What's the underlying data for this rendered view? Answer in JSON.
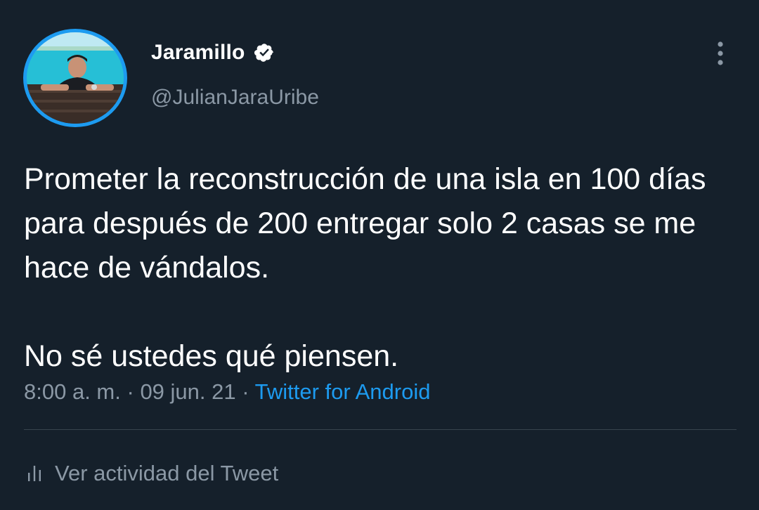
{
  "tweet": {
    "author": {
      "display_name": "Jaramillo",
      "handle": "@JulianJaraUribe",
      "verified": true,
      "avatar_icon": "profile-photo"
    },
    "text_paragraphs": [
      "Prometer la reconstrucción de una isla en 100 días para después de 200 entregar solo 2 casas se me hace de vándalos.",
      "No sé ustedes qué piensen."
    ],
    "time": "8:00 a. m.",
    "separator": "·",
    "date": "09 jun. 21",
    "source": "Twitter for Android",
    "activity_label": "Ver actividad del Tweet"
  },
  "icons": {
    "more": "more-vertical-icon",
    "verified": "verified-badge-icon",
    "activity": "activity-bars-icon"
  },
  "colors": {
    "background": "#15202b",
    "accent": "#1d9bf0",
    "secondary_text": "#8b98a5",
    "divider": "#38444d"
  }
}
